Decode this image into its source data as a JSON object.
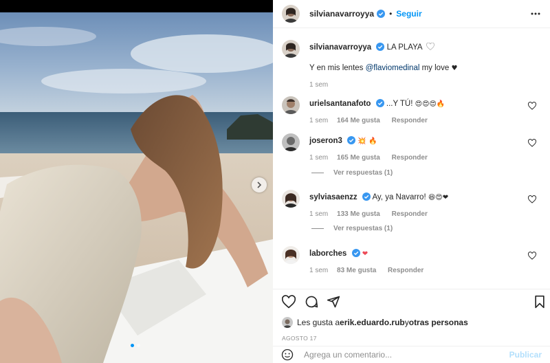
{
  "post": {
    "author": "silvianavarroyya",
    "separator": "•",
    "follow_label": "Seguir",
    "photo_alt": "photo",
    "carousel": {
      "count": 2,
      "active_index": 0
    }
  },
  "caption": {
    "user": "silvianavarroyya",
    "title": "LA PLAYA",
    "text_before": "Y en mis lentes ",
    "mention": "@flaviomedinal",
    "text_after": " my love",
    "heart": "♥",
    "time": "1 sem"
  },
  "comments": [
    {
      "user": "urielsantanafoto",
      "verified": true,
      "text": "...Y TÚ!",
      "emojis": "😍😍😍🔥",
      "time": "1 sem",
      "likes": "164 Me gusta",
      "reply_label": "Responder",
      "replies": ""
    },
    {
      "user": "joseron3",
      "verified": true,
      "text": "",
      "emojis": "💥 🔥",
      "time": "1 sem",
      "likes": "165 Me gusta",
      "reply_label": "Responder",
      "replies": "Ver respuestas (1)"
    },
    {
      "user": "sylviasaenzz",
      "verified": true,
      "text": "Ay, ya Navarro!",
      "emojis": "😆😍❤",
      "time": "1 sem",
      "likes": "133 Me gusta",
      "reply_label": "Responder",
      "replies": "Ver respuestas (1)"
    },
    {
      "user": "laborches",
      "verified": true,
      "text": "",
      "emojis": "❤",
      "time": "1 sem",
      "likes": "83 Me gusta",
      "reply_label": "Responder",
      "replies": ""
    }
  ],
  "likes_line": {
    "prefix": "Les gusta a ",
    "user": "erik.eduardo.rub",
    "mid": " y ",
    "others": "otras personas"
  },
  "date": "AGOSTO 17",
  "add_comment": {
    "placeholder": "Agrega un comentario...",
    "publish_label": "Publicar"
  },
  "colors": {
    "accent": "#0095f6",
    "verified": "#3897f0",
    "heart": "#ed4956",
    "muted": "#8e8e8e"
  },
  "icons": [
    "verified-icon",
    "more-icon",
    "heart-icon",
    "comment-icon",
    "share-icon",
    "bookmark-icon",
    "emoji-icon",
    "chevron-right-icon"
  ]
}
